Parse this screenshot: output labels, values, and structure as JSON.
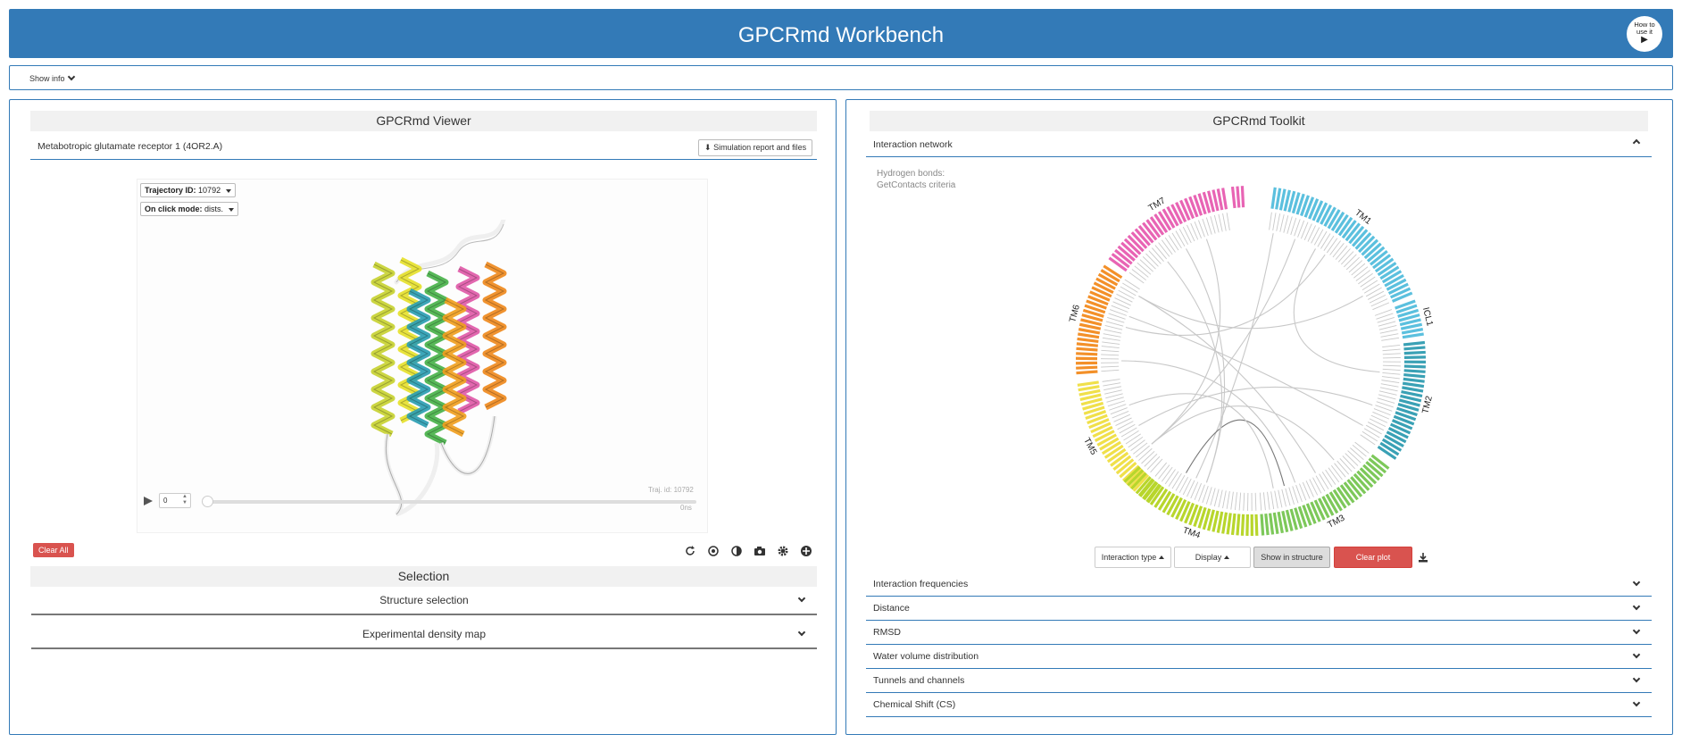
{
  "header": {
    "title": "GPCRmd Workbench",
    "howto_line1": "How to",
    "howto_line2": "use it",
    "howto_play": "▶"
  },
  "infobar": {
    "label": "Show info"
  },
  "viewer_panel": {
    "title": "GPCRmd Viewer",
    "protein_name": "Metabotropic glutamate receptor 1 (4OR2.A)",
    "report_button": "Simulation report and files",
    "trajectory_label": "Trajectory ID:",
    "trajectory_value": "10792",
    "click_mode_label": "On click mode:",
    "click_mode_value": "dists.",
    "frame_value": "0",
    "traj_id_overlay": "Traj. id: 10792",
    "time_overlay": "0ns",
    "clear_all": "Clear All",
    "selection_title": "Selection",
    "accordion": [
      "Structure selection",
      "Experimental density map"
    ],
    "helix_colors": [
      "#c8d232",
      "#e6e12d",
      "#49b24a",
      "#2b9eb3",
      "#e05aa8",
      "#ef8a1e",
      "#f0a020",
      "#efefef"
    ]
  },
  "toolkit_panel": {
    "title": "GPCRmd Toolkit",
    "interaction_network": "Interaction network",
    "info_line1": "Hydrogen bonds:",
    "info_line2": "GetContacts criteria",
    "segments": [
      {
        "name": "TM1",
        "color": "#5bc0de"
      },
      {
        "name": "ICL1",
        "color": "#5bc0de"
      },
      {
        "name": "TM2",
        "color": "#3aa1b5"
      },
      {
        "name": "TM3",
        "color": "#7dc85a"
      },
      {
        "name": "TM4",
        "color": "#b8d62c"
      },
      {
        "name": "TM5",
        "color": "#f0e04a"
      },
      {
        "name": "TM6",
        "color": "#f39029"
      },
      {
        "name": "TM7",
        "color": "#e864b4"
      }
    ],
    "buttons": {
      "interaction_type": "Interaction type",
      "display": "Display",
      "show_in_structure": "Show in structure",
      "clear_plot": "Clear plot"
    },
    "sections": [
      "Interaction frequencies",
      "Distance",
      "RMSD",
      "Water volume distribution",
      "Tunnels and channels",
      "Chemical Shift (CS)"
    ]
  }
}
